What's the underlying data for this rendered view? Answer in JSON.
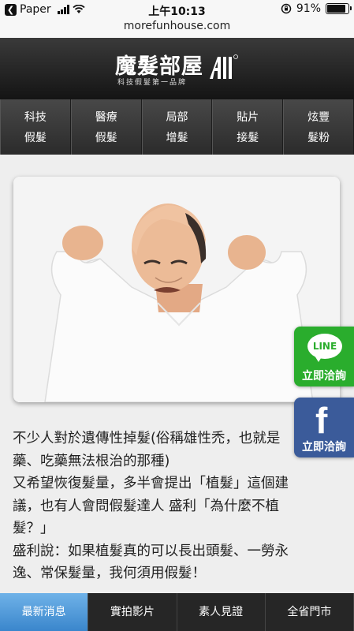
{
  "status_bar": {
    "back_app": "Paper",
    "time": "上午10:13",
    "battery": "91%",
    "battery_level": 0.91
  },
  "url": "morefunhouse.com",
  "logo": {
    "title": "魔髮部屋",
    "subtitle": "科技假髮第一品牌"
  },
  "nav": [
    {
      "line1": "科技",
      "line2": "假髮"
    },
    {
      "line1": "醫療",
      "line2": "假髮"
    },
    {
      "line1": "局部",
      "line2": "增髮"
    },
    {
      "line1": "貼片",
      "line2": "接髮"
    },
    {
      "line1": "炫豐",
      "line2": "髮粉"
    }
  ],
  "article": {
    "lines": [
      "不少人對於遺傳性掉髮(俗稱雄性禿，也就是",
      "藥、吃藥無法根治的那種)",
      "又希望恢復髮量，多半會提出「植髮」這個建",
      "議，也有人會問假髮達人 盛利「為什麼不植",
      "髮？」",
      "盛利說：如果植髮真的可以長出頭髮、一勞永",
      "逸、常保髮量，我何須用假髮！"
    ]
  },
  "floating": {
    "line_label": "LINE",
    "line_caption": "立即洽詢",
    "fb_letter": "f",
    "fb_caption": "立即洽詢"
  },
  "bottom_tabs": [
    "最新消息",
    "實拍影片",
    "素人見證",
    "全省門市"
  ],
  "colors": {
    "line_green": "#2aad2d",
    "facebook_blue": "#3b5b9a",
    "active_tab": "#4a96d8"
  }
}
